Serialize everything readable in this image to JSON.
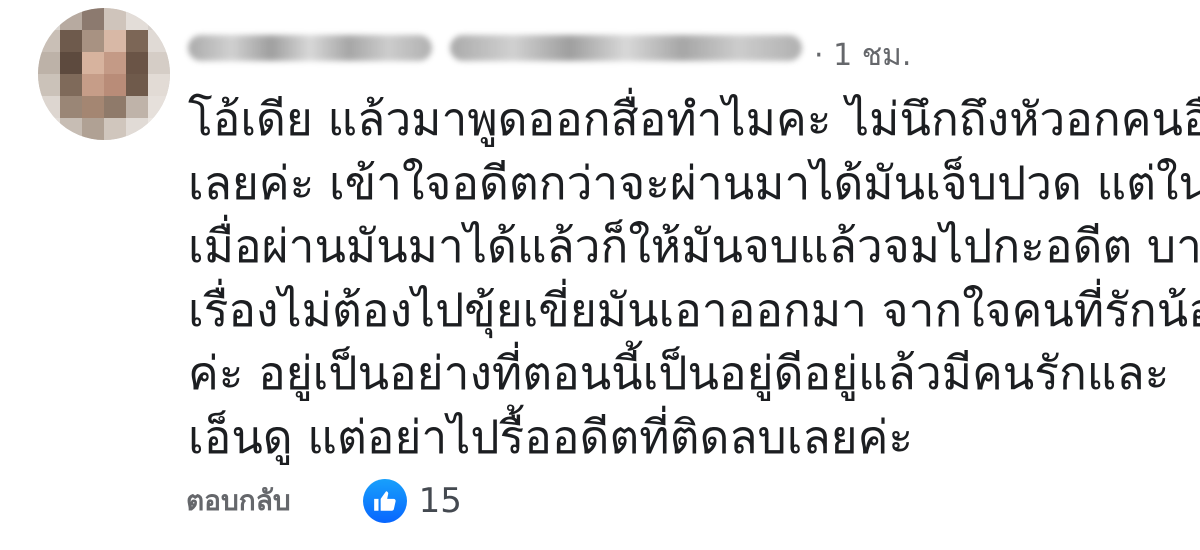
{
  "comment": {
    "timestamp": "· 1 ชม.",
    "lines": [
      "โอ้เดีย แล้วมาพูดออกสื่อทำไมคะ  ไม่นึกถึงหัวอกคนอื่น",
      "เลยค่ะ เข้าใจอดีตกว่าจะผ่านมาได้มันเจ็บปวด แต่ใน",
      "เมื่อผ่านมันมาได้แล้วก็ให้มันจบแล้วจมไปกะอดีต บาง",
      "เรื่องไม่ต้องไปขุ้ยเขี่ยมันเอาออกมา จากใจคนที่รักน้อง",
      "ค่ะ อยู่เป็นอย่างที่ตอนนี้เป็นอยู่ดีอยู่แล้วมีคนรักและ",
      "เอ็นดู แต่อย่าไปรื้ออดีตที่ติดลบเลยค่ะ"
    ],
    "reply_label": "ตอบกลับ",
    "reaction": {
      "icon": "thumbs-up-icon",
      "count": "15",
      "color": "#1877f2"
    }
  },
  "avatar_pixels": [
    "#d9d4cf",
    "#b7aaa0",
    "#8c7a6f",
    "#cfc4bb",
    "#e3ddd8",
    "#d7d1cc",
    "#c9bfb6",
    "#6e5a4c",
    "#a89282",
    "#d8b8a6",
    "#7c6656",
    "#e0dad5",
    "#bdb2a8",
    "#5d4a3e",
    "#d7b39e",
    "#c49a86",
    "#6a5446",
    "#d5cdc6",
    "#cbc2b9",
    "#7f6a5a",
    "#c69d88",
    "#b98c78",
    "#6f5a4b",
    "#e2dbd5",
    "#ddd6d0",
    "#9a8676",
    "#a48672",
    "#8f7a6a",
    "#bfb3a9",
    "#e6e0db",
    "#e3ddd8",
    "#c7bdb4",
    "#b0a194",
    "#d0c6bd",
    "#e1dbd6",
    "#ece7e3"
  ]
}
